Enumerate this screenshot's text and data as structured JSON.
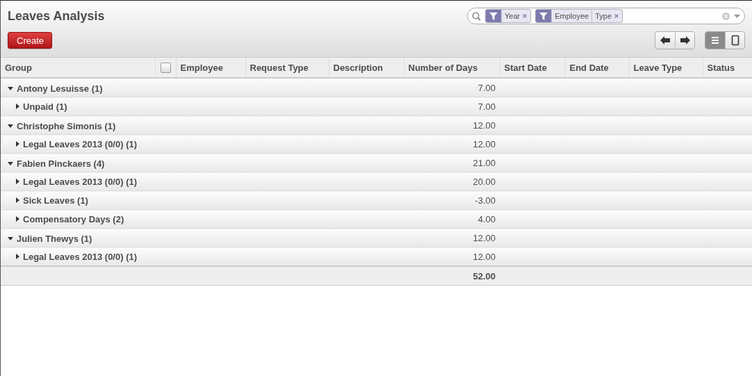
{
  "title": "Leaves Analysis",
  "create_button": "Create",
  "search": {
    "facets": [
      {
        "values": [
          "Year"
        ]
      },
      {
        "values": [
          "Employee",
          "Type"
        ]
      }
    ]
  },
  "view_switcher": [
    {
      "kind": "list",
      "selected": true
    },
    {
      "kind": "form",
      "selected": false
    }
  ],
  "table": {
    "columns": [
      "Group",
      "Employee",
      "Request Type",
      "Description",
      "Number of Days",
      "Start Date",
      "End Date",
      "Leave Type",
      "Status"
    ],
    "header_checkbox": {
      "checked": false
    },
    "groups": [
      {
        "label": "Antony Lesuisse (1)",
        "days": "7.00",
        "expanded": true,
        "children": [
          {
            "label": "Unpaid (1)",
            "days": "7.00",
            "expanded": false
          }
        ]
      },
      {
        "label": "Christophe Simonis (1)",
        "days": "12.00",
        "expanded": true,
        "children": [
          {
            "label": "Legal Leaves 2013 (0/0) (1)",
            "days": "12.00",
            "expanded": false
          }
        ]
      },
      {
        "label": "Fabien Pinckaers (4)",
        "days": "21.00",
        "expanded": true,
        "children": [
          {
            "label": "Legal Leaves 2013 (0/0) (1)",
            "days": "20.00",
            "expanded": false
          },
          {
            "label": "Sick Leaves (1)",
            "days": "-3.00",
            "expanded": false
          },
          {
            "label": "Compensatory Days (2)",
            "days": "4.00",
            "expanded": false
          }
        ]
      },
      {
        "label": "Julien Thewys (1)",
        "days": "12.00",
        "expanded": true,
        "children": [
          {
            "label": "Legal Leaves 2013 (0/0) (1)",
            "days": "12.00",
            "expanded": false
          }
        ]
      }
    ],
    "total": "52.00"
  }
}
